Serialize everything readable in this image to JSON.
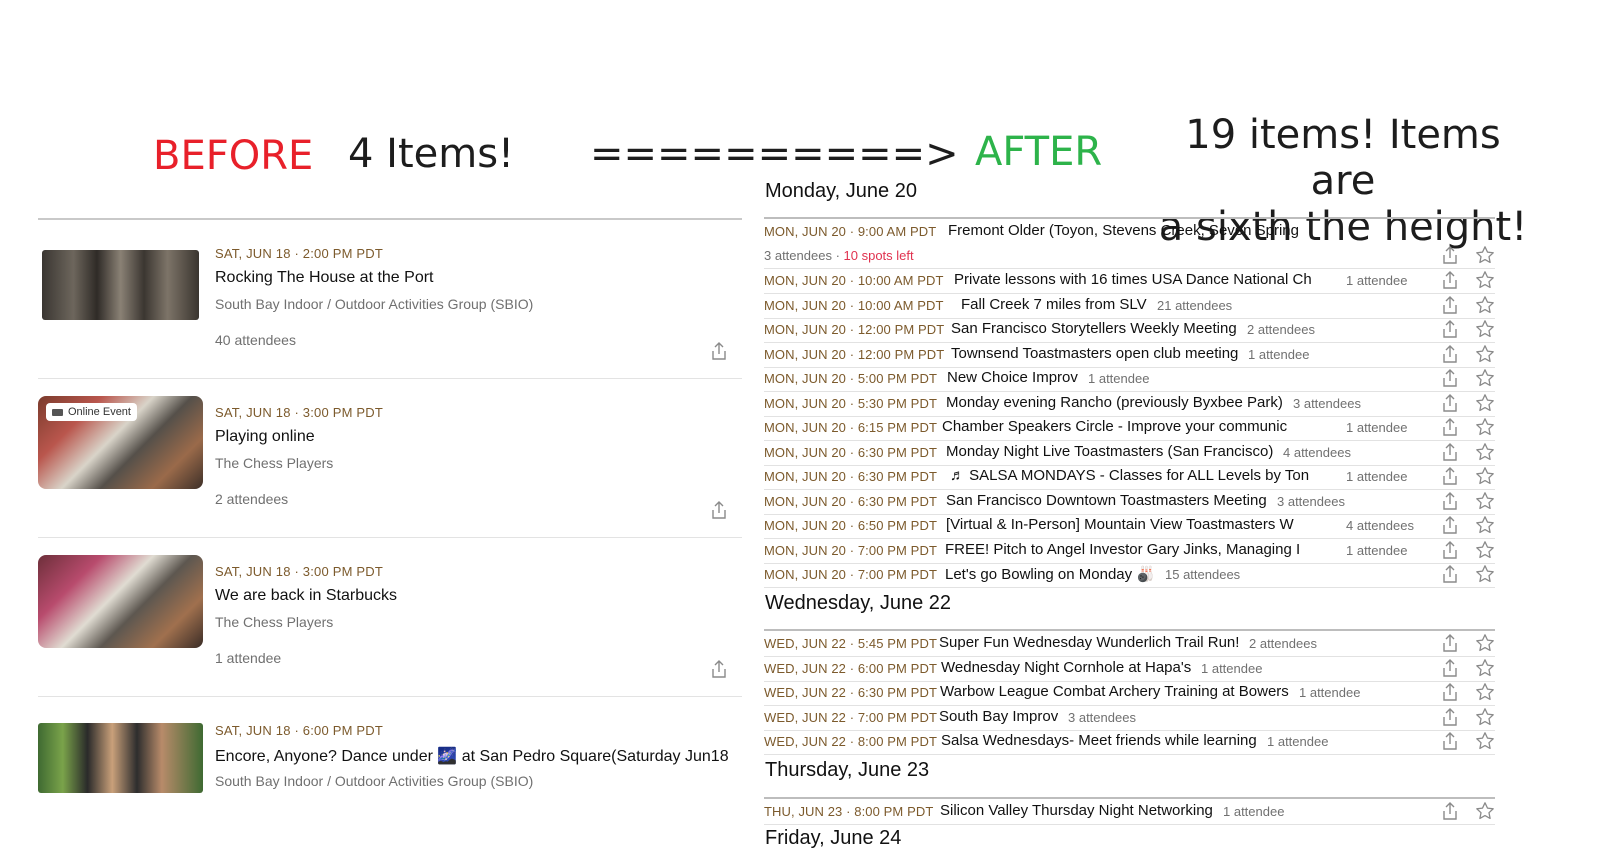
{
  "headline": {
    "before": "BEFORE",
    "before_count": "4 Items!",
    "arrow": "==========>",
    "after": "AFTER",
    "after_note_line1": "19 items! Items are",
    "after_note_line2": "a sixth the height!"
  },
  "colors": {
    "before": "#e8202a",
    "after": "#2db34a",
    "date": "#7c5a2c",
    "spots": "#e0324f"
  },
  "before_events": [
    {
      "date": "SAT, JUN 18 · 2:00 PM PDT",
      "title": "Rocking The House at the Port",
      "group": "South Bay Indoor / Outdoor Activities Group (SBIO)",
      "attendees": "40 attendees",
      "online": ""
    },
    {
      "date": "SAT, JUN 18 · 3:00 PM PDT",
      "title": "Playing online",
      "group": "The Chess Players",
      "attendees": "2 attendees",
      "online": "Online Event"
    },
    {
      "date": "SAT, JUN 18 · 3:00 PM PDT",
      "title": "We are back in Starbucks",
      "group": "The Chess Players",
      "attendees": "1 attendee",
      "online": ""
    },
    {
      "date": "SAT, JUN 18 · 6:00 PM PDT",
      "title": "Encore, Anyone? Dance under 🌌 at San Pedro Square(Saturday Jun18",
      "group": "South Bay Indoor / Outdoor Activities Group (SBIO)",
      "attendees": "",
      "online": ""
    }
  ],
  "days": [
    {
      "label": "Monday, June 20",
      "events": [
        {
          "date": "MON, JUN 20 · 9:00 AM PDT",
          "title": "Fremont Older (Toyon, Stevens Creek, Seven Spring",
          "attendees": "3 attendees",
          "spots": "10 spots left"
        },
        {
          "date": "MON, JUN 20 · 10:00 AM PDT",
          "title": "Private lessons with 16 times USA Dance National Ch",
          "attendees": "1 attendee"
        },
        {
          "date": "MON, JUN 20 · 10:00 AM PDT",
          "title": "Fall Creek 7 miles from SLV",
          "attendees": "21 attendees"
        },
        {
          "date": "MON, JUN 20 · 12:00 PM PDT",
          "title": "San Francisco Storytellers Weekly Meeting",
          "attendees": "2 attendees"
        },
        {
          "date": "MON, JUN 20 · 12:00 PM PDT",
          "title": "Townsend Toastmasters open club meeting",
          "attendees": "1 attendee"
        },
        {
          "date": "MON, JUN 20 · 5:00 PM PDT",
          "title": "New Choice Improv",
          "attendees": "1 attendee"
        },
        {
          "date": "MON, JUN 20 · 5:30 PM PDT",
          "title": "Monday evening Rancho (previously Byxbee Park)",
          "attendees": "3 attendees"
        },
        {
          "date": "MON, JUN 20 · 6:15 PM PDT",
          "title": "Chamber Speakers Circle - Improve your communic",
          "attendees": "1 attendee"
        },
        {
          "date": "MON, JUN 20 · 6:30 PM PDT",
          "title": "Monday Night Live Toastmasters (San Francisco)",
          "attendees": "4 attendees"
        },
        {
          "date": "MON, JUN 20 · 6:30 PM PDT",
          "title": "♬ SALSA MONDAYS - Classes for ALL Levels by Ton",
          "attendees": "1 attendee"
        },
        {
          "date": "MON, JUN 20 · 6:30 PM PDT",
          "title": "San Francisco Downtown Toastmasters Meeting",
          "attendees": "3 attendees"
        },
        {
          "date": "MON, JUN 20 · 6:50 PM PDT",
          "title": "[Virtual & In-Person] Mountain View Toastmasters W",
          "attendees": "4 attendees"
        },
        {
          "date": "MON, JUN 20 · 7:00 PM PDT",
          "title": "FREE! Pitch to Angel Investor Gary Jinks, Managing I",
          "attendees": "1 attendee"
        },
        {
          "date": "MON, JUN 20 · 7:00 PM PDT",
          "title": "Let's go Bowling on Monday 🎳",
          "attendees": "15 attendees"
        }
      ]
    },
    {
      "label": "Wednesday, June 22",
      "events": [
        {
          "date": "WED, JUN 22 · 5:45 PM PDT",
          "title": "Super Fun Wednesday Wunderlich Trail Run!",
          "attendees": "2 attendees"
        },
        {
          "date": "WED, JUN 22 · 6:00 PM PDT",
          "title": "Wednesday Night Cornhole at Hapa's",
          "attendees": "1 attendee"
        },
        {
          "date": "WED, JUN 22 · 6:30 PM PDT",
          "title": "Warbow League Combat Archery Training at Bowers",
          "attendees": "1 attendee"
        },
        {
          "date": "WED, JUN 22 · 7:00 PM PDT",
          "title": "South Bay Improv",
          "attendees": "3 attendees"
        },
        {
          "date": "WED, JUN 22 · 8:00 PM PDT",
          "title": "Salsa Wednesdays- Meet friends while learning",
          "attendees": "1 attendee"
        }
      ]
    },
    {
      "label": "Thursday, June 23",
      "events": [
        {
          "date": "THU, JUN 23 · 8:00 PM PDT",
          "title": "Silicon Valley Thursday Night Networking",
          "attendees": "1 attendee"
        }
      ]
    },
    {
      "label": "Friday, June 24",
      "events": []
    }
  ]
}
